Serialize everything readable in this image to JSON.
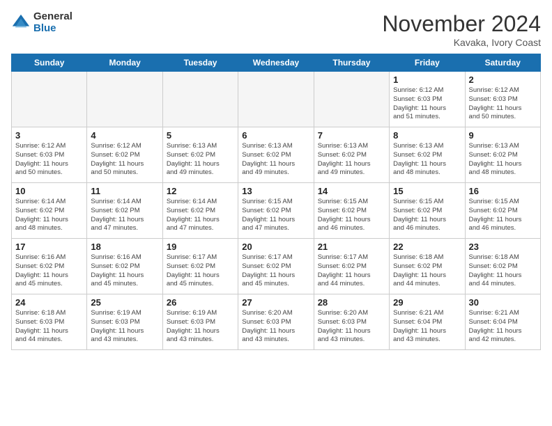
{
  "logo": {
    "general": "General",
    "blue": "Blue"
  },
  "header": {
    "month": "November 2024",
    "location": "Kavaka, Ivory Coast"
  },
  "weekdays": [
    "Sunday",
    "Monday",
    "Tuesday",
    "Wednesday",
    "Thursday",
    "Friday",
    "Saturday"
  ],
  "weeks": [
    [
      {
        "day": "",
        "info": "",
        "empty": true
      },
      {
        "day": "",
        "info": "",
        "empty": true
      },
      {
        "day": "",
        "info": "",
        "empty": true
      },
      {
        "day": "",
        "info": "",
        "empty": true
      },
      {
        "day": "",
        "info": "",
        "empty": true
      },
      {
        "day": "1",
        "info": "Sunrise: 6:12 AM\nSunset: 6:03 PM\nDaylight: 11 hours\nand 51 minutes.",
        "empty": false
      },
      {
        "day": "2",
        "info": "Sunrise: 6:12 AM\nSunset: 6:03 PM\nDaylight: 11 hours\nand 50 minutes.",
        "empty": false
      }
    ],
    [
      {
        "day": "3",
        "info": "Sunrise: 6:12 AM\nSunset: 6:03 PM\nDaylight: 11 hours\nand 50 minutes.",
        "empty": false
      },
      {
        "day": "4",
        "info": "Sunrise: 6:12 AM\nSunset: 6:02 PM\nDaylight: 11 hours\nand 50 minutes.",
        "empty": false
      },
      {
        "day": "5",
        "info": "Sunrise: 6:13 AM\nSunset: 6:02 PM\nDaylight: 11 hours\nand 49 minutes.",
        "empty": false
      },
      {
        "day": "6",
        "info": "Sunrise: 6:13 AM\nSunset: 6:02 PM\nDaylight: 11 hours\nand 49 minutes.",
        "empty": false
      },
      {
        "day": "7",
        "info": "Sunrise: 6:13 AM\nSunset: 6:02 PM\nDaylight: 11 hours\nand 49 minutes.",
        "empty": false
      },
      {
        "day": "8",
        "info": "Sunrise: 6:13 AM\nSunset: 6:02 PM\nDaylight: 11 hours\nand 48 minutes.",
        "empty": false
      },
      {
        "day": "9",
        "info": "Sunrise: 6:13 AM\nSunset: 6:02 PM\nDaylight: 11 hours\nand 48 minutes.",
        "empty": false
      }
    ],
    [
      {
        "day": "10",
        "info": "Sunrise: 6:14 AM\nSunset: 6:02 PM\nDaylight: 11 hours\nand 48 minutes.",
        "empty": false
      },
      {
        "day": "11",
        "info": "Sunrise: 6:14 AM\nSunset: 6:02 PM\nDaylight: 11 hours\nand 47 minutes.",
        "empty": false
      },
      {
        "day": "12",
        "info": "Sunrise: 6:14 AM\nSunset: 6:02 PM\nDaylight: 11 hours\nand 47 minutes.",
        "empty": false
      },
      {
        "day": "13",
        "info": "Sunrise: 6:15 AM\nSunset: 6:02 PM\nDaylight: 11 hours\nand 47 minutes.",
        "empty": false
      },
      {
        "day": "14",
        "info": "Sunrise: 6:15 AM\nSunset: 6:02 PM\nDaylight: 11 hours\nand 46 minutes.",
        "empty": false
      },
      {
        "day": "15",
        "info": "Sunrise: 6:15 AM\nSunset: 6:02 PM\nDaylight: 11 hours\nand 46 minutes.",
        "empty": false
      },
      {
        "day": "16",
        "info": "Sunrise: 6:15 AM\nSunset: 6:02 PM\nDaylight: 11 hours\nand 46 minutes.",
        "empty": false
      }
    ],
    [
      {
        "day": "17",
        "info": "Sunrise: 6:16 AM\nSunset: 6:02 PM\nDaylight: 11 hours\nand 45 minutes.",
        "empty": false
      },
      {
        "day": "18",
        "info": "Sunrise: 6:16 AM\nSunset: 6:02 PM\nDaylight: 11 hours\nand 45 minutes.",
        "empty": false
      },
      {
        "day": "19",
        "info": "Sunrise: 6:17 AM\nSunset: 6:02 PM\nDaylight: 11 hours\nand 45 minutes.",
        "empty": false
      },
      {
        "day": "20",
        "info": "Sunrise: 6:17 AM\nSunset: 6:02 PM\nDaylight: 11 hours\nand 45 minutes.",
        "empty": false
      },
      {
        "day": "21",
        "info": "Sunrise: 6:17 AM\nSunset: 6:02 PM\nDaylight: 11 hours\nand 44 minutes.",
        "empty": false
      },
      {
        "day": "22",
        "info": "Sunrise: 6:18 AM\nSunset: 6:02 PM\nDaylight: 11 hours\nand 44 minutes.",
        "empty": false
      },
      {
        "day": "23",
        "info": "Sunrise: 6:18 AM\nSunset: 6:02 PM\nDaylight: 11 hours\nand 44 minutes.",
        "empty": false
      }
    ],
    [
      {
        "day": "24",
        "info": "Sunrise: 6:18 AM\nSunset: 6:03 PM\nDaylight: 11 hours\nand 44 minutes.",
        "empty": false
      },
      {
        "day": "25",
        "info": "Sunrise: 6:19 AM\nSunset: 6:03 PM\nDaylight: 11 hours\nand 43 minutes.",
        "empty": false
      },
      {
        "day": "26",
        "info": "Sunrise: 6:19 AM\nSunset: 6:03 PM\nDaylight: 11 hours\nand 43 minutes.",
        "empty": false
      },
      {
        "day": "27",
        "info": "Sunrise: 6:20 AM\nSunset: 6:03 PM\nDaylight: 11 hours\nand 43 minutes.",
        "empty": false
      },
      {
        "day": "28",
        "info": "Sunrise: 6:20 AM\nSunset: 6:03 PM\nDaylight: 11 hours\nand 43 minutes.",
        "empty": false
      },
      {
        "day": "29",
        "info": "Sunrise: 6:21 AM\nSunset: 6:04 PM\nDaylight: 11 hours\nand 43 minutes.",
        "empty": false
      },
      {
        "day": "30",
        "info": "Sunrise: 6:21 AM\nSunset: 6:04 PM\nDaylight: 11 hours\nand 42 minutes.",
        "empty": false
      }
    ]
  ]
}
